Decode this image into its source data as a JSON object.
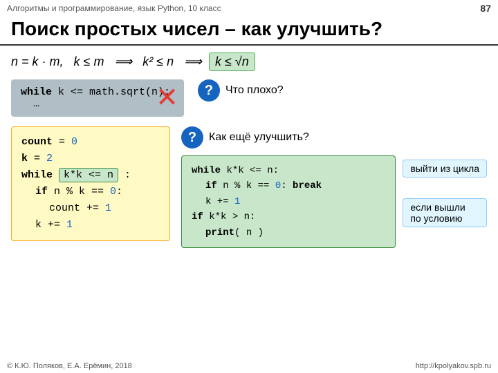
{
  "header": {
    "left": "Алгоритмы и программирование, язык Python, 10 класс",
    "right": "87"
  },
  "title": "Поиск простых чисел – как улучшить?",
  "math": {
    "line": "n = k · m,   k ≤ m   ⟹ k² ≤ n   ⟹",
    "highlight": "k ≤ √n"
  },
  "bad_code": {
    "line1": "while  k <= math.sqrt(n):",
    "line2": "  …"
  },
  "callout_bad": "Что плохо?",
  "left_code": {
    "line1_a": "count",
    "line1_b": " = ",
    "line1_c": "0",
    "line2_a": "k",
    "line2_b": " = ",
    "line2_c": "2",
    "line3_kw": "while",
    "line3_hl": "k*k <= n",
    "line3_rest": " :",
    "line4_kw": "  if",
    "line4_rest": "  n % k ==",
    "line4_num": "0",
    "line4_end": ":",
    "line5_a": "    count +=",
    "line5_num": "1",
    "line6_a": "  k +=",
    "line6_num": "1"
  },
  "callout_improve": "Как ещё улучшить?",
  "green_code": {
    "line1_kw": "while",
    "line1_rest": "  k*k <= n:",
    "line2_kw": "  if",
    "line2_rest": "  n % k ==",
    "line2_num": "0",
    "line2_kw2": ": break",
    "line3_a": "  k +=",
    "line3_num": "1",
    "line4_kw": "if",
    "line4_rest": " k*k > n:",
    "line5_kw": "  print",
    "line5_rest": "( n )"
  },
  "tooltip1": "выйти из цикла",
  "tooltip2": "если вышли\nпо условию",
  "footer": {
    "left": "© К.Ю. Поляков, Е.А. Ерёмин, 2018",
    "right": "http://kpolyakov.spb.ru"
  }
}
